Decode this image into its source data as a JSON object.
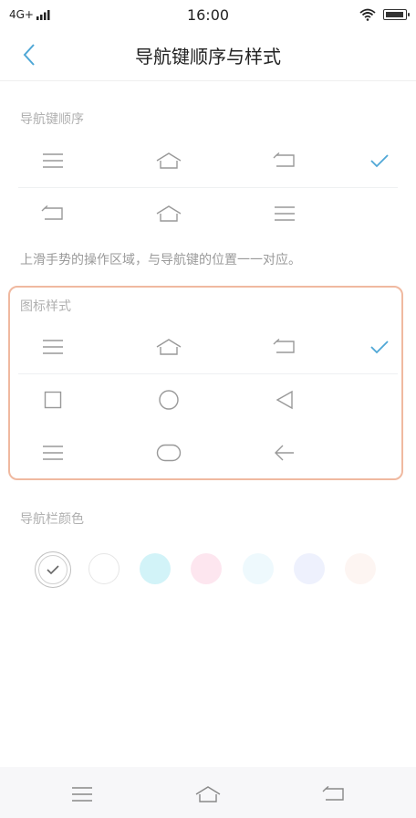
{
  "status": {
    "network": "4G+",
    "time": "16:00"
  },
  "header": {
    "title": "导航键顺序与样式"
  },
  "order_section": {
    "label": "导航键顺序",
    "options": [
      {
        "icons": [
          "menu-icon",
          "home-icon",
          "back-icon"
        ],
        "selected": true
      },
      {
        "icons": [
          "back-icon",
          "home-icon",
          "menu-icon"
        ],
        "selected": false
      }
    ],
    "note": "上滑手势的操作区域，与导航键的位置一一对应。"
  },
  "style_section": {
    "label": "图标样式",
    "options": [
      {
        "icons": [
          "menu-icon",
          "home-icon",
          "back-icon"
        ],
        "selected": true
      },
      {
        "icons": [
          "square-icon",
          "circle-icon",
          "triangle-back-icon"
        ],
        "selected": false
      },
      {
        "icons": [
          "menu-icon",
          "pill-icon",
          "arrow-left-icon"
        ],
        "selected": false
      }
    ]
  },
  "color_section": {
    "label": "导航栏颜色",
    "swatches": [
      "#ffffff",
      "#ffffff",
      "#d2f3f8",
      "#fde6ef",
      "#eef9fd",
      "#eef1fd",
      "#fdf5f2"
    ],
    "selected_index": 0
  },
  "colors": {
    "accent": "#4fa7d6",
    "highlight": "#f0b9a0"
  }
}
